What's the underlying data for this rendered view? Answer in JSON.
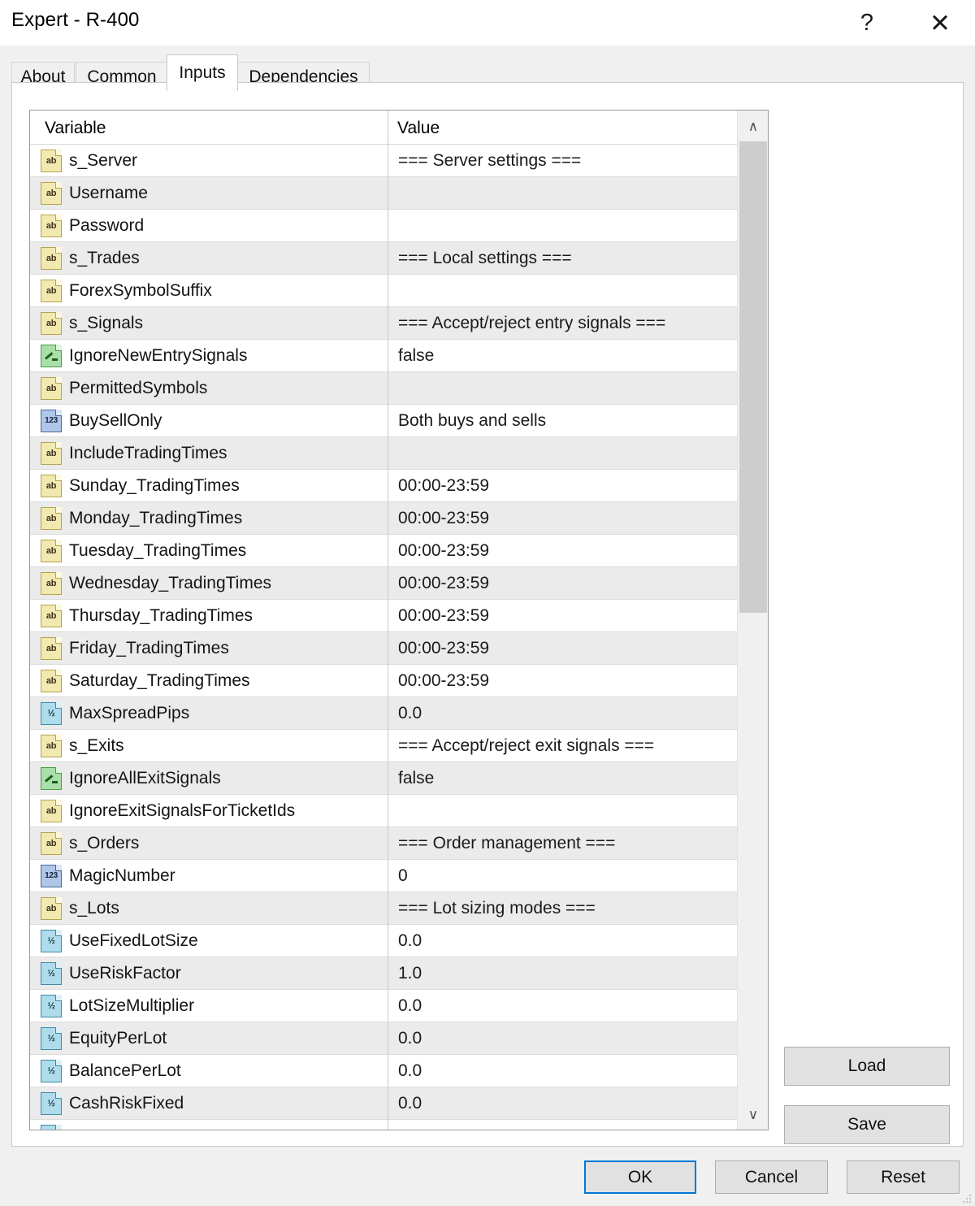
{
  "window": {
    "title": "Expert - R-400",
    "help_button": "?",
    "close_button": "✕"
  },
  "tabs": [
    {
      "label": "About",
      "active": false
    },
    {
      "label": "Common",
      "active": false
    },
    {
      "label": "Inputs",
      "active": true
    },
    {
      "label": "Dependencies",
      "active": false
    }
  ],
  "table": {
    "columns": [
      "Variable",
      "Value"
    ],
    "rows": [
      {
        "type": "string",
        "variable": "s_Server",
        "value": "=== Server settings ==="
      },
      {
        "type": "string",
        "variable": "Username",
        "value": ""
      },
      {
        "type": "string",
        "variable": "Password",
        "value": ""
      },
      {
        "type": "string",
        "variable": "s_Trades",
        "value": "=== Local settings ==="
      },
      {
        "type": "string",
        "variable": "ForexSymbolSuffix",
        "value": ""
      },
      {
        "type": "string",
        "variable": "s_Signals",
        "value": "=== Accept/reject entry signals ==="
      },
      {
        "type": "bool",
        "variable": "IgnoreNewEntrySignals",
        "value": "false"
      },
      {
        "type": "string",
        "variable": "PermittedSymbols",
        "value": ""
      },
      {
        "type": "int",
        "variable": "BuySellOnly",
        "value": "Both buys and sells"
      },
      {
        "type": "string",
        "variable": "IncludeTradingTimes",
        "value": ""
      },
      {
        "type": "string",
        "variable": "Sunday_TradingTimes",
        "value": "00:00-23:59"
      },
      {
        "type": "string",
        "variable": "Monday_TradingTimes",
        "value": "00:00-23:59"
      },
      {
        "type": "string",
        "variable": "Tuesday_TradingTimes",
        "value": "00:00-23:59"
      },
      {
        "type": "string",
        "variable": "Wednesday_TradingTimes",
        "value": "00:00-23:59"
      },
      {
        "type": "string",
        "variable": "Thursday_TradingTimes",
        "value": "00:00-23:59"
      },
      {
        "type": "string",
        "variable": "Friday_TradingTimes",
        "value": "00:00-23:59"
      },
      {
        "type": "string",
        "variable": "Saturday_TradingTimes",
        "value": "00:00-23:59"
      },
      {
        "type": "double",
        "variable": "MaxSpreadPips",
        "value": "0.0"
      },
      {
        "type": "string",
        "variable": "s_Exits",
        "value": "=== Accept/reject exit signals ==="
      },
      {
        "type": "bool",
        "variable": "IgnoreAllExitSignals",
        "value": "false"
      },
      {
        "type": "string",
        "variable": "IgnoreExitSignalsForTicketIds",
        "value": ""
      },
      {
        "type": "string",
        "variable": "s_Orders",
        "value": "=== Order management ==="
      },
      {
        "type": "int",
        "variable": "MagicNumber",
        "value": "0"
      },
      {
        "type": "string",
        "variable": "s_Lots",
        "value": "=== Lot sizing modes ==="
      },
      {
        "type": "double",
        "variable": "UseFixedLotSize",
        "value": "0.0"
      },
      {
        "type": "double",
        "variable": "UseRiskFactor",
        "value": "1.0"
      },
      {
        "type": "double",
        "variable": "LotSizeMultiplier",
        "value": "0.0"
      },
      {
        "type": "double",
        "variable": "EquityPerLot",
        "value": "0.0"
      },
      {
        "type": "double",
        "variable": "BalancePerLot",
        "value": "0.0"
      },
      {
        "type": "double",
        "variable": "CashRiskFixed",
        "value": "0.0"
      },
      {
        "type": "double",
        "variable": "",
        "value": ""
      }
    ]
  },
  "type_icon_glyphs": {
    "string": "ab",
    "int": "123",
    "double": "½",
    "bool": ""
  },
  "scrollbar": {
    "up_arrow": "∧",
    "down_arrow": "∨"
  },
  "side_buttons": {
    "load": "Load",
    "save": "Save"
  },
  "footer_buttons": {
    "ok": "OK",
    "cancel": "Cancel",
    "reset": "Reset"
  },
  "colors": {
    "focus_border": "#0078d7",
    "row_alt": "#ebebeb",
    "dialog_bg": "#f0f0f0"
  }
}
